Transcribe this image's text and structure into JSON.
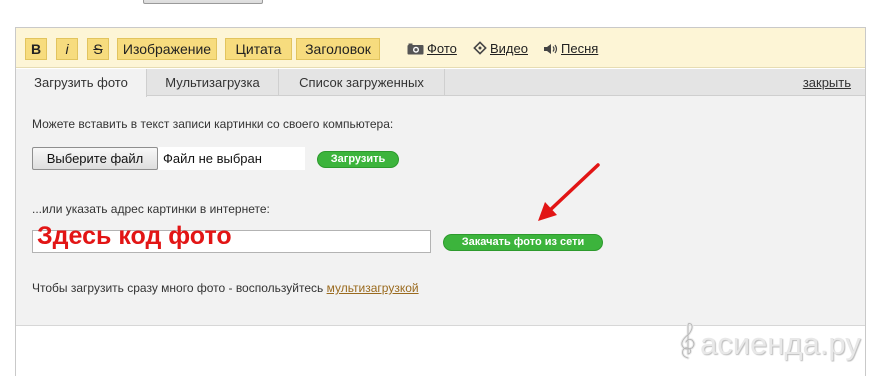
{
  "toolbar": {
    "bold": "B",
    "italic": "i",
    "strike": "S",
    "image": "Изображение",
    "quote": "Цитата",
    "heading": "Заголовок",
    "photo": "Фото",
    "video": "Видео",
    "song": "Песня"
  },
  "tabs": {
    "upload_photo": "Загрузить фото",
    "multi_upload": "Мультизагрузка",
    "uploaded_list": "Список загруженных",
    "close": "закрыть"
  },
  "upload": {
    "label": "Можете вставить в текст записи картинки со своего компьютера:",
    "choose_file": "Выберите файл",
    "file_status": "Файл не выбран",
    "upload_button": "Загрузить"
  },
  "url": {
    "label": "...или указать адрес картинки в интернете:",
    "value": "",
    "overlay_text": "Здесь код фото",
    "fetch_button": "Закачать фото из сети"
  },
  "footer": {
    "text": "Чтобы загрузить сразу много фото - воспользуйтесь ",
    "link": "мультизагрузкой"
  },
  "colors": {
    "toolbar_bg": "#fdf5d6",
    "toolbar_button": "#f7dc7e",
    "green_button": "#3cb43c",
    "annotation_red": "#e21515",
    "link_brown": "#9a6a1e"
  },
  "watermark": "асиенда.ру"
}
